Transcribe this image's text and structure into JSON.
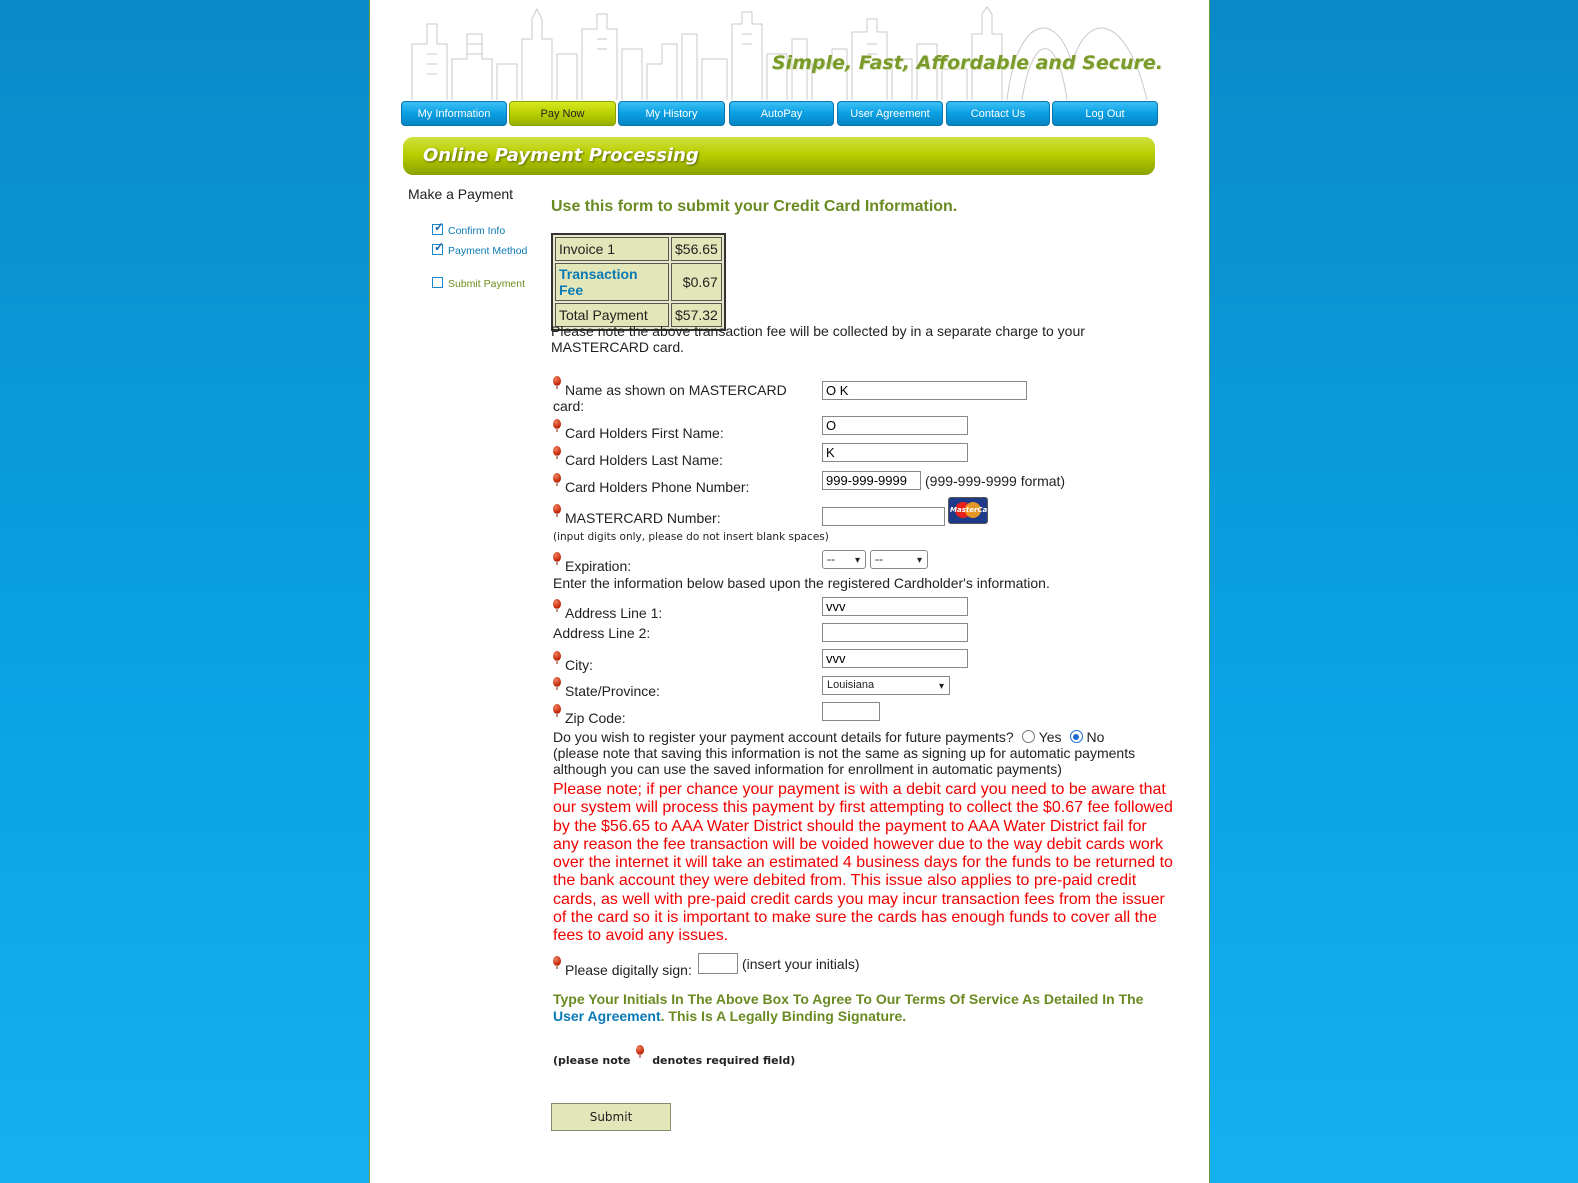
{
  "header": {
    "tagline": "Simple, Fast, Affordable and Secure."
  },
  "nav": [
    {
      "label": "My Information"
    },
    {
      "label": "Pay Now"
    },
    {
      "label": "My History"
    },
    {
      "label": "AutoPay"
    },
    {
      "label": "User Agreement"
    },
    {
      "label": "Contact Us"
    },
    {
      "label": "Log Out"
    }
  ],
  "banner": {
    "title": "Online Payment Processing"
  },
  "sidebar": {
    "title": "Make a Payment",
    "steps": [
      {
        "label": "Confirm Info",
        "done": true
      },
      {
        "label": "Payment Method",
        "done": true
      },
      {
        "label": "Submit Payment",
        "done": false
      }
    ]
  },
  "main": {
    "heading": "Use this form to submit your Credit Card Information.",
    "fees": [
      {
        "label": "Invoice 1",
        "amount": "$56.65"
      },
      {
        "label": "Transaction Fee",
        "amount": "$0.67"
      },
      {
        "label": "Total Payment",
        "amount": "$57.32"
      }
    ],
    "fee_note": "Please note the above transaction fee will be collected by in a separate charge to your MASTERCARD card.",
    "form": {
      "name_on_card_label": "Name as shown on MASTERCARD card:",
      "name_on_card_value": "O K",
      "first_name_label": "Card Holders First Name:",
      "first_name_value": "O",
      "last_name_label": "Card Holders Last Name:",
      "last_name_value": "K",
      "phone_label": "Card Holders Phone Number:",
      "phone_value": "999-999-9999",
      "phone_hint": "(999-999-9999 format)",
      "card_number_label": "MASTERCARD Number:",
      "card_number_value": "",
      "card_logo_text": "MasterCard",
      "card_number_hint": "(input digits only, please do not insert blank spaces)",
      "expiration_label": "Expiration:",
      "exp_month": "--",
      "exp_year": "--",
      "address_intro": "Enter the information below based upon the registered Cardholder's information.",
      "address1_label": "Address Line 1:",
      "address1_value": "vvv",
      "address2_label": "Address Line 2:",
      "address2_value": "",
      "city_label": "City:",
      "city_value": "vvv",
      "state_label": "State/Province:",
      "state_value": "Louisiana",
      "zip_label": "Zip Code:",
      "zip_value": "",
      "register_question": "Do you wish to register your payment account details for future payments?",
      "register_yes": "Yes",
      "register_no": "No",
      "register_selected": "No",
      "register_note": "(please note that saving this information is not the same as signing up for automatic payments although you can use the saved information for enrollment in automatic payments)",
      "warning": "Please note; if per chance your payment is with a debit card you need to be aware that our system will process this payment by first attempting to collect the $0.67 fee followed by the $56.65 to AAA Water District should the payment to AAA Water District fail for any reason the fee transaction will be voided however due to the way debit cards work over the internet it will take an estimated 4 business days for the funds to be returned to the bank account they were debited from. This issue also applies to pre-paid credit cards, as well with pre-paid credit cards you may incur transaction fees from the issuer of the card so it is important to make sure the cards has enough funds to cover all the fees to avoid any issues.",
      "sign_label": "Please digitally sign:",
      "sign_value": "",
      "sign_hint": "(insert your initials)",
      "terms_part1": "Type Your Initials In The Above Box To Agree To Our Terms Of Service As Detailed In The ",
      "terms_link": "User Agreement",
      "terms_part2": ". This Is A Legally Binding Signature.",
      "required_note_before": "(please note",
      "required_note_after": "denotes required field)",
      "submit_label": "Submit"
    }
  }
}
